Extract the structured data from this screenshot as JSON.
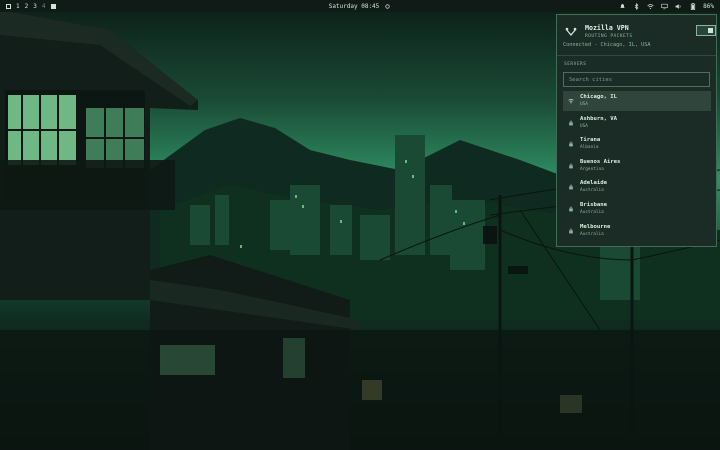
{
  "topbar": {
    "workspaces": [
      "1",
      "2",
      "3",
      "4"
    ],
    "clock": "Saturday 08:45",
    "battery": "86%"
  },
  "vpn": {
    "title": "Mozilla VPN",
    "subtitle": "ROUTING PACKETS",
    "status": "Connected - Chicago, IL, USA",
    "servers_label": "SERVERS",
    "search_placeholder": "Search cities",
    "servers": [
      {
        "city": "Chicago, IL",
        "country": "USA",
        "selected": true
      },
      {
        "city": "Ashburn, VA",
        "country": "USA",
        "selected": false
      },
      {
        "city": "Tirana",
        "country": "Albania",
        "selected": false
      },
      {
        "city": "Buenos Aires",
        "country": "Argentina",
        "selected": false
      },
      {
        "city": "Adelaide",
        "country": "Australia",
        "selected": false
      },
      {
        "city": "Brisbane",
        "country": "Australia",
        "selected": false
      },
      {
        "city": "Melbourne",
        "country": "Australia",
        "selected": false
      }
    ]
  },
  "icons": {
    "tray": [
      "notification-bell-icon",
      "bluetooth-icon",
      "wifi-icon",
      "display-icon",
      "volume-icon",
      "battery-icon"
    ]
  },
  "colors": {
    "accent": "#3f6e57",
    "panel_bg": "#1b2b25",
    "text": "#cfe6d6"
  }
}
